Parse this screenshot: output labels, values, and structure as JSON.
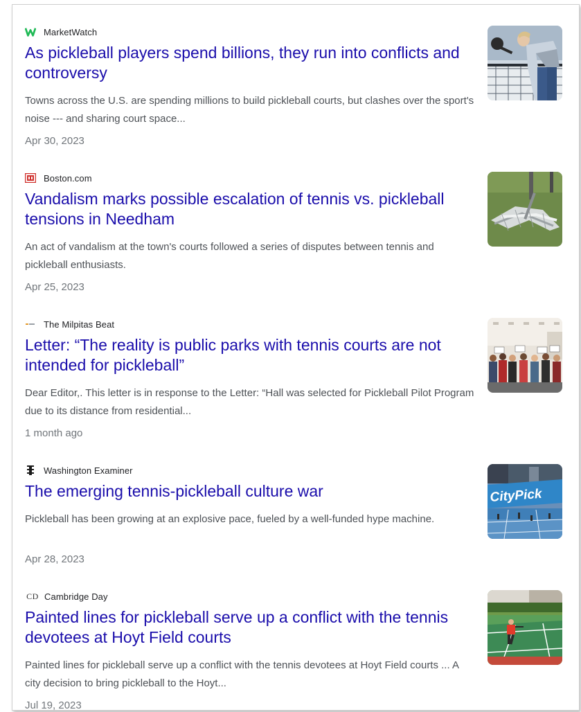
{
  "results": [
    {
      "source": "MarketWatch",
      "title": "As pickleball players spend billions, they run into conflicts and controversy",
      "snippet": "Towns across the U.S. are spending millions to build pickleball courts, but clashes over the sport's noise --- and sharing court space...",
      "date": "Apr 30, 2023",
      "logo_icon": "marketwatch-logo",
      "thumb_icon": "pickleball-player-photo"
    },
    {
      "source": "Boston.com",
      "title": "Vandalism marks possible escalation of tennis vs. pickleball tensions in Needham",
      "snippet": "An act of vandalism at the town's courts followed a series of disputes between tennis and pickleball enthusiasts.",
      "date": "Apr 25, 2023",
      "logo_icon": "boston-com-logo",
      "thumb_icon": "vandalized-net-photo"
    },
    {
      "source": "The Milpitas Beat",
      "title": "Letter: “The reality is public parks with tennis courts are not intended for pickleball”",
      "snippet": "Dear Editor,. This letter is in response to the Letter: “Hall was selected for Pickleball Pilot Program due to its distance from residential...",
      "date": "1 month ago",
      "logo_icon": "milpitas-beat-logo",
      "thumb_icon": "crowd-with-signs-photo"
    },
    {
      "source": "Washington Examiner",
      "title": "The emerging tennis-pickleball culture war",
      "snippet": "Pickleball has been growing at an explosive pace, fueled by a well-funded hype machine.",
      "date": "Apr 28, 2023",
      "logo_icon": "washington-examiner-logo",
      "thumb_icon": "city-pickle-courts-photo",
      "thumb_text": "CityPick"
    },
    {
      "source": "Cambridge Day",
      "title": "Painted lines for pickleball serve up a conflict with the tennis devotees at Hoyt Field courts",
      "snippet": "Painted lines for pickleball serve up a conflict with the tennis devotees at Hoyt Field courts ... A city decision to bring pickleball to the Hoyt...",
      "date": "Jul 19, 2023",
      "logo_icon": "cambridge-day-logo",
      "logo_text": "CD",
      "thumb_icon": "hoyt-field-court-photo"
    }
  ],
  "colors": {
    "title": "#1a0dab",
    "snippet": "#4d5156",
    "date": "#70757a",
    "marketwatch_green": "#1db954"
  }
}
